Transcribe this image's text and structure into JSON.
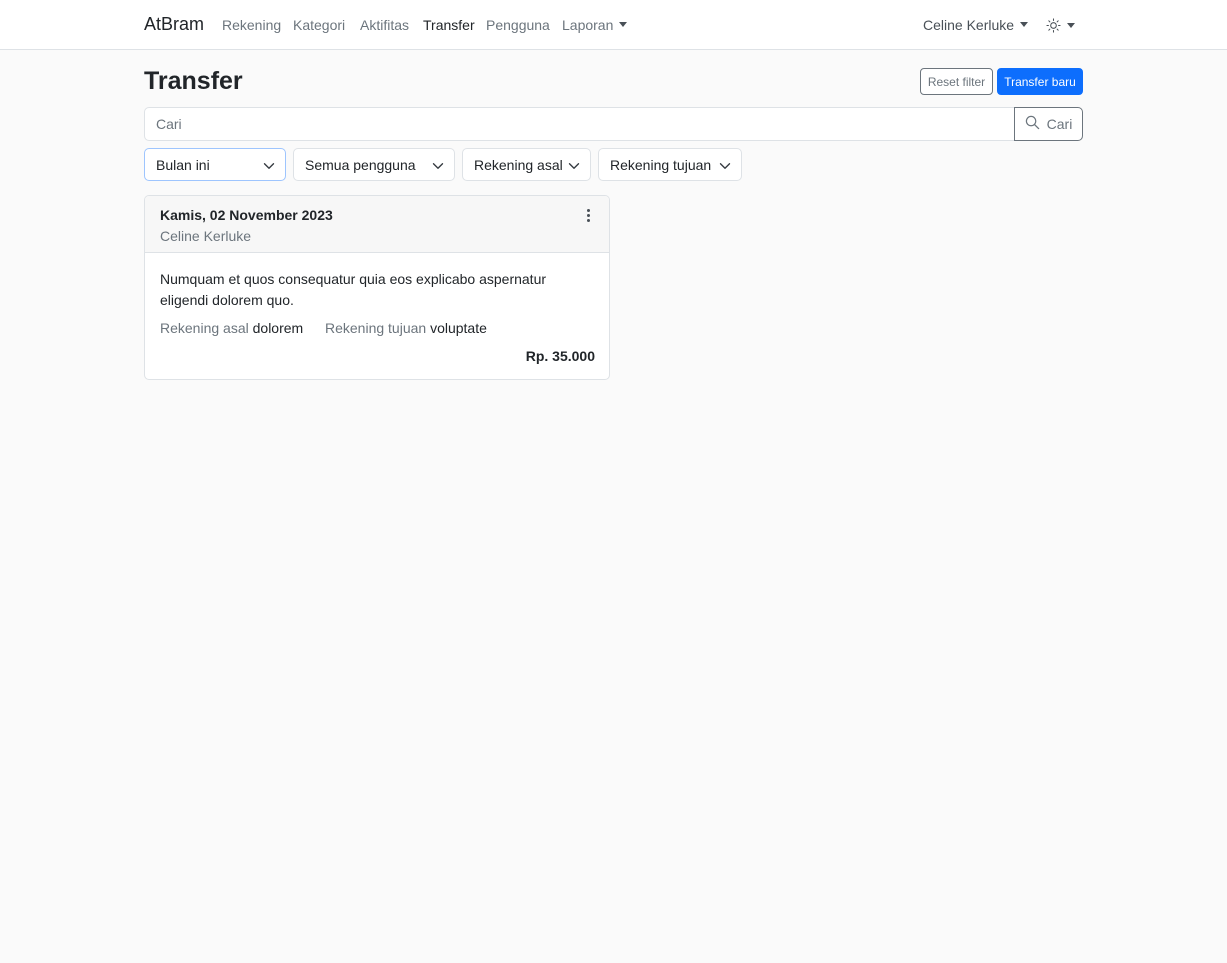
{
  "app": {
    "brand": "AtBram"
  },
  "nav": {
    "items": [
      {
        "label": "Rekening"
      },
      {
        "label": "Kategori"
      },
      {
        "label": "Aktifitas"
      },
      {
        "label": "Transfer"
      },
      {
        "label": "Pengguna"
      },
      {
        "label": "Laporan"
      }
    ],
    "active": "Transfer",
    "user": "Celine Kerluke",
    "theme_icon": "sun-icon"
  },
  "page": {
    "title": "Transfer",
    "reset_label": "Reset filter",
    "new_label": "Transfer baru"
  },
  "search": {
    "placeholder": "Cari",
    "button_label": "Cari"
  },
  "filters": {
    "period": "Bulan ini",
    "user": "Semua pengguna",
    "source": "Rekening asal",
    "destination": "Rekening tujuan"
  },
  "transfers": [
    {
      "date": "Kamis, 02 November 2023",
      "user": "Celine Kerluke",
      "description": "Numquam et quos consequatur quia eos explicabo aspernatur eligendi dolorem quo.",
      "source_label": "Rekening asal",
      "source": "dolorem",
      "destination_label": "Rekening tujuan",
      "destination": "voluptate",
      "amount": "Rp. 35.000"
    }
  ],
  "colors": {
    "primary": "#0d6efd",
    "muted": "#6c757d",
    "background": "#fafafa"
  }
}
